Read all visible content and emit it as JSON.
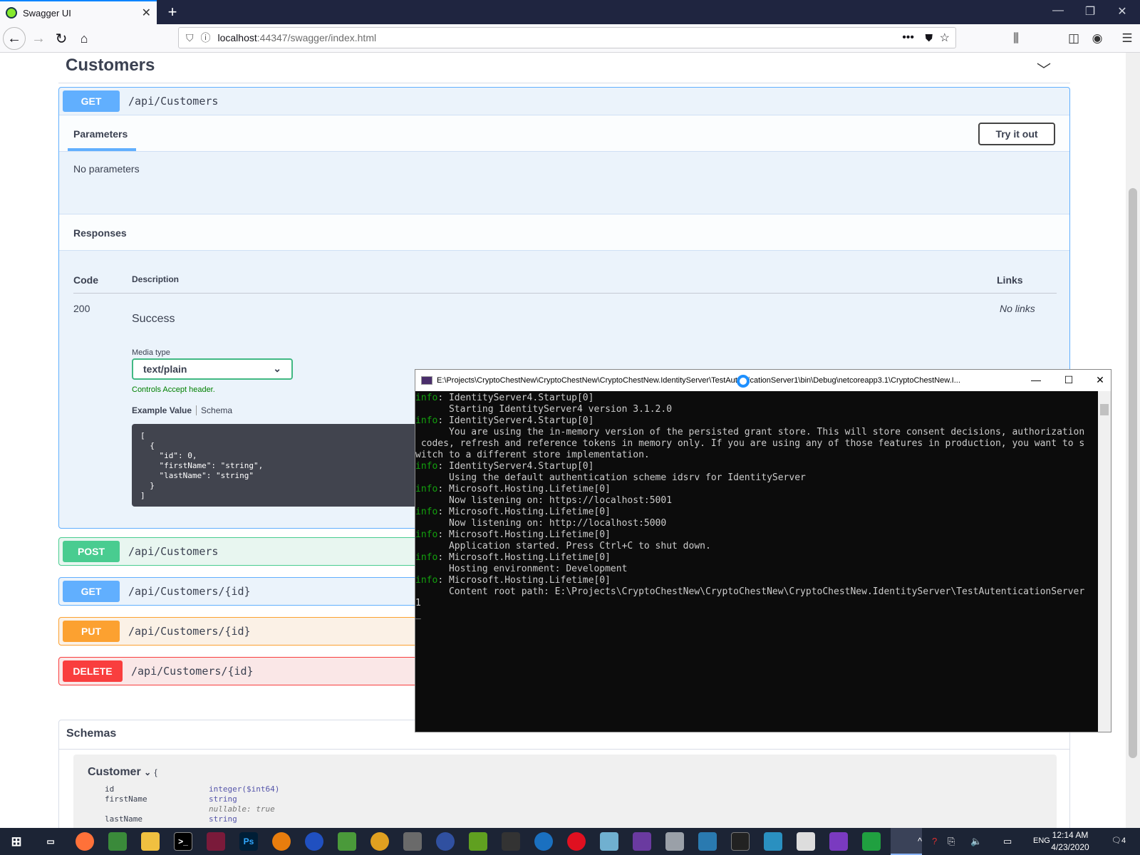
{
  "browser": {
    "tab_title": "Swagger UI",
    "url_host": "localhost",
    "url_rest": ":44347/swagger/index.html"
  },
  "tag": {
    "title": "Customers"
  },
  "get_customers": {
    "method": "GET",
    "path": "/api/Customers",
    "params_tab": "Parameters",
    "try_it_out": "Try it out",
    "no_params": "No parameters",
    "responses_title": "Responses",
    "col_code": "Code",
    "col_description": "Description",
    "col_links": "Links",
    "code": "200",
    "description": "Success",
    "no_links": "No links",
    "media_type_label": "Media type",
    "media_type": "text/plain",
    "accept_note": "Controls Accept header.",
    "example_value_tab": "Example Value",
    "schema_tab": "Schema",
    "example_json": "[\n  {\n    \"id\": 0,\n    \"firstName\": \"string\",\n    \"lastName\": \"string\"\n  }\n]"
  },
  "operations": [
    {
      "method": "POST",
      "path": "/api/Customers"
    },
    {
      "method": "GET",
      "path": "/api/Customers/{id}"
    },
    {
      "method": "PUT",
      "path": "/api/Customers/{id}"
    },
    {
      "method": "DELETE",
      "path": "/api/Customers/{id}"
    }
  ],
  "schemas": {
    "title": "Schemas",
    "model_name": "Customer",
    "brace": "{",
    "props": [
      {
        "name": "id",
        "type": "integer($int64)"
      },
      {
        "name": "firstName",
        "type": "string"
      },
      {
        "name": "",
        "type": "nullable: true"
      },
      {
        "name": "lastName",
        "type": "string"
      }
    ]
  },
  "console": {
    "title": "E:\\Projects\\CryptoChestNew\\CryptoChestNew\\CryptoChestNew.IdentityServer\\TestAutenticationServer1\\bin\\Debug\\netcoreapp3.1\\CryptoChestNew.I...",
    "lines": [
      {
        "tag": "info",
        "text": ": IdentityServer4.Startup[0]"
      },
      {
        "tag": "",
        "text": "      Starting IdentityServer4 version 3.1.2.0"
      },
      {
        "tag": "info",
        "text": ": IdentityServer4.Startup[0]"
      },
      {
        "tag": "",
        "text": "      You are using the in-memory version of the persisted grant store. This will store consent decisions, authorization"
      },
      {
        "tag": "",
        "text": " codes, refresh and reference tokens in memory only. If you are using any of those features in production, you want to s"
      },
      {
        "tag": "",
        "text": "witch to a different store implementation."
      },
      {
        "tag": "info",
        "text": ": IdentityServer4.Startup[0]"
      },
      {
        "tag": "",
        "text": "      Using the default authentication scheme idsrv for IdentityServer"
      },
      {
        "tag": "info",
        "text": ": Microsoft.Hosting.Lifetime[0]"
      },
      {
        "tag": "",
        "text": "      Now listening on: https://localhost:5001"
      },
      {
        "tag": "info",
        "text": ": Microsoft.Hosting.Lifetime[0]"
      },
      {
        "tag": "",
        "text": "      Now listening on: http://localhost:5000"
      },
      {
        "tag": "info",
        "text": ": Microsoft.Hosting.Lifetime[0]"
      },
      {
        "tag": "",
        "text": "      Application started. Press Ctrl+C to shut down."
      },
      {
        "tag": "info",
        "text": ": Microsoft.Hosting.Lifetime[0]"
      },
      {
        "tag": "",
        "text": "      Hosting environment: Development"
      },
      {
        "tag": "info",
        "text": ": Microsoft.Hosting.Lifetime[0]"
      },
      {
        "tag": "",
        "text": "      Content root path: E:\\Projects\\CryptoChestNew\\CryptoChestNew\\CryptoChestNew.IdentityServer\\TestAutenticationServer"
      },
      {
        "tag": "",
        "text": "1"
      },
      {
        "tag": "",
        "text": "_"
      }
    ]
  },
  "taskbar": {
    "lang": "ENG",
    "time": "12:14 AM",
    "date": "4/23/2020",
    "notifications": "4"
  },
  "colors": {
    "get": "#61affe",
    "post": "#49cc90",
    "put": "#fca130",
    "delete": "#f93e3e"
  }
}
